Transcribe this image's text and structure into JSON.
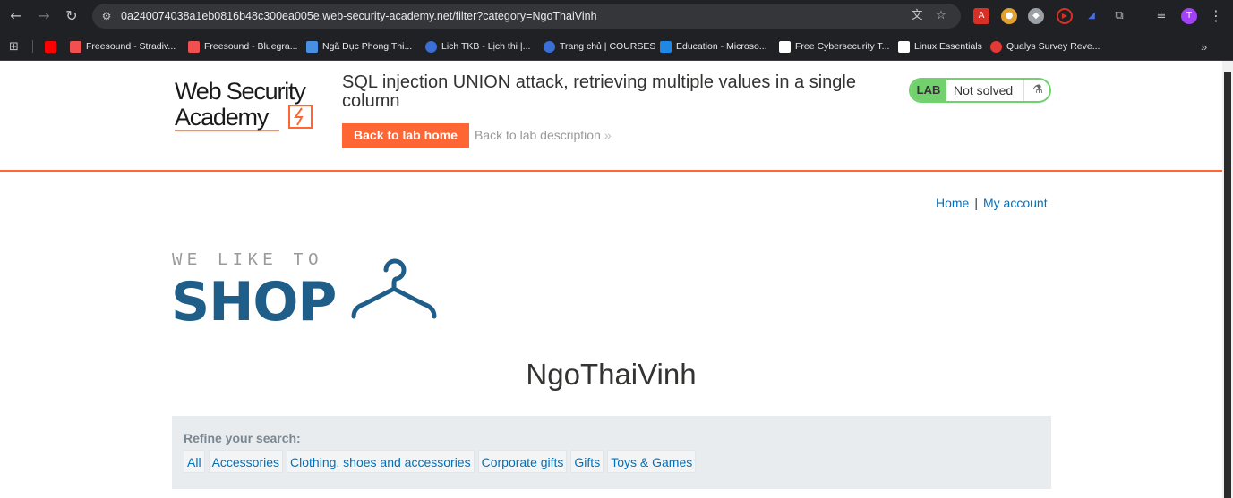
{
  "browser": {
    "url": "0a240074038a1eb0816b48c300ea005e.web-security-academy.net/filter?category=NgoThaiVinh",
    "avatar_initial": "T",
    "bookmarks": [
      {
        "label": "",
        "color": "#ff0000"
      },
      {
        "label": "Freesound - Stradiv...",
        "color": "#f05050"
      },
      {
        "label": "Freesound - Bluegra...",
        "color": "#f05050"
      },
      {
        "label": "Ngã Dục Phong Thi...",
        "color": "#4a90e2"
      },
      {
        "label": "Lich TKB - Lịch thi |...",
        "color": "#3a6fd8"
      },
      {
        "label": "Trang chủ | COURSES",
        "color": "#3a6fd8"
      },
      {
        "label": "Education - Microso...",
        "color": "#1e88e5"
      },
      {
        "label": "Free Cybersecurity T...",
        "color": "#ffffff"
      },
      {
        "label": "Linux Essentials",
        "color": "#ffffff"
      },
      {
        "label": "Qualys Survey Reve...",
        "color": "#e53935"
      }
    ]
  },
  "academy": {
    "logo_line1": "Web Security",
    "logo_line2": "Academy",
    "lab_title": "SQL injection UNION attack, retrieving multiple values in a single column",
    "back_home": "Back to lab home",
    "back_description": "Back to lab description",
    "back_chevron": "»",
    "lab_tag": "LAB",
    "lab_status": "Not solved",
    "accent_color": "#ff6633",
    "status_color": "#70d16d"
  },
  "nav": {
    "home": "Home",
    "separator": "|",
    "my_account": "My account"
  },
  "shop_logo": {
    "line1": "WE LIKE TO",
    "line2": "SHOP"
  },
  "category_heading": "NgoThaiVinh",
  "filters": {
    "label": "Refine your search:",
    "items": [
      "All",
      "Accessories",
      "Clothing, shoes and accessories",
      "Corporate gifts",
      "Gifts",
      "Toys & Games"
    ]
  }
}
